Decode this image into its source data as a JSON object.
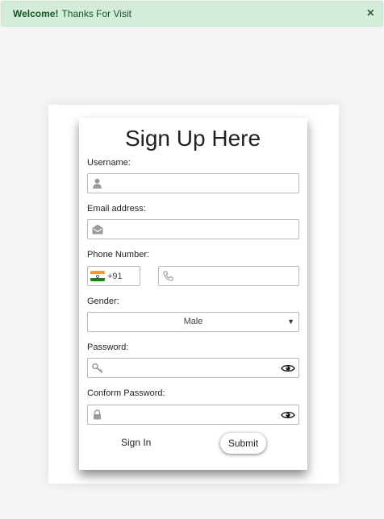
{
  "alert": {
    "strong": "Welcome!",
    "message": "Thanks For Visit",
    "close": "×"
  },
  "form": {
    "title": "Sign Up Here",
    "username_label": "Username:",
    "email_label": "Email address:",
    "phone_label": "Phone Number:",
    "country_code": "+91",
    "gender_label": "Gender:",
    "gender_value": "Male",
    "password_label": "Password:",
    "confirm_label": "Conform Password:",
    "signin_label": "Sign In",
    "submit_label": "Submit"
  },
  "icons": {
    "username": "user-icon",
    "email": "envelope-icon",
    "country": "india-flag-icon",
    "phone": "phone-icon",
    "password": "key-icon",
    "confirm": "lock-icon",
    "toggle": "eye-icon"
  },
  "colors": {
    "alert_bg": "#d4edda",
    "alert_text": "#155724",
    "flag_saffron": "#ff9933",
    "flag_white": "#ffffff",
    "flag_green": "#138808"
  }
}
